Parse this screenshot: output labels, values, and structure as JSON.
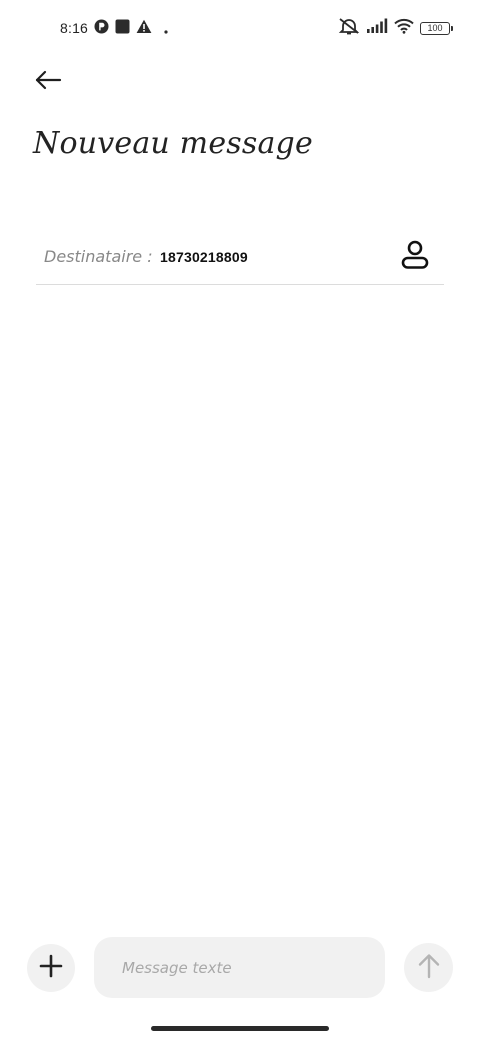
{
  "status_bar": {
    "time": "8:16",
    "battery_level": "100",
    "icons": [
      "app-notification-icon",
      "square-notification-icon",
      "warning-icon",
      "dot-icon",
      "muted-vibrate-icon",
      "signal-icon",
      "wifi-icon",
      "battery-icon"
    ]
  },
  "header": {
    "back_icon": "arrow-left-icon",
    "title": "Nouveau message"
  },
  "recipient": {
    "label": "Destinataire :",
    "value": "18730218809",
    "contact_icon": "person-icon"
  },
  "composer": {
    "add_icon": "plus-icon",
    "placeholder": "Message texte",
    "send_icon": "arrow-up-icon"
  }
}
